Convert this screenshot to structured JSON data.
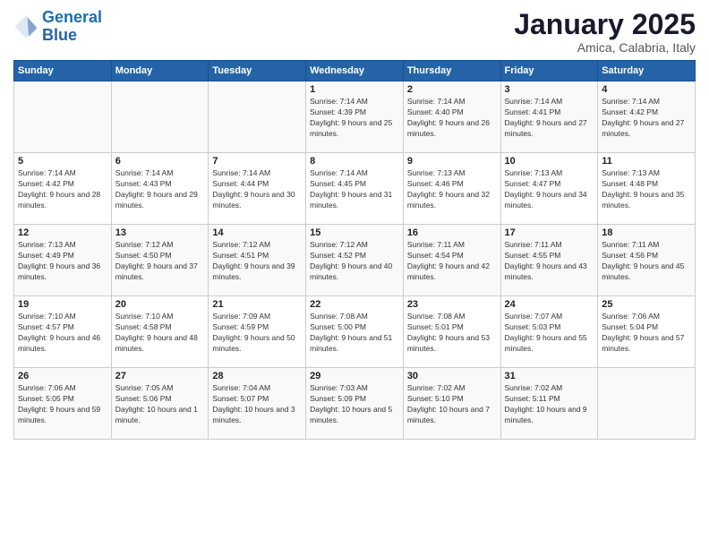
{
  "header": {
    "logo_line1": "General",
    "logo_line2": "Blue",
    "month": "January 2025",
    "location": "Amica, Calabria, Italy"
  },
  "weekdays": [
    "Sunday",
    "Monday",
    "Tuesday",
    "Wednesday",
    "Thursday",
    "Friday",
    "Saturday"
  ],
  "weeks": [
    [
      {
        "day": "",
        "info": ""
      },
      {
        "day": "",
        "info": ""
      },
      {
        "day": "",
        "info": ""
      },
      {
        "day": "1",
        "info": "Sunrise: 7:14 AM\nSunset: 4:39 PM\nDaylight: 9 hours and 25 minutes."
      },
      {
        "day": "2",
        "info": "Sunrise: 7:14 AM\nSunset: 4:40 PM\nDaylight: 9 hours and 26 minutes."
      },
      {
        "day": "3",
        "info": "Sunrise: 7:14 AM\nSunset: 4:41 PM\nDaylight: 9 hours and 27 minutes."
      },
      {
        "day": "4",
        "info": "Sunrise: 7:14 AM\nSunset: 4:42 PM\nDaylight: 9 hours and 27 minutes."
      }
    ],
    [
      {
        "day": "5",
        "info": "Sunrise: 7:14 AM\nSunset: 4:42 PM\nDaylight: 9 hours and 28 minutes."
      },
      {
        "day": "6",
        "info": "Sunrise: 7:14 AM\nSunset: 4:43 PM\nDaylight: 9 hours and 29 minutes."
      },
      {
        "day": "7",
        "info": "Sunrise: 7:14 AM\nSunset: 4:44 PM\nDaylight: 9 hours and 30 minutes."
      },
      {
        "day": "8",
        "info": "Sunrise: 7:14 AM\nSunset: 4:45 PM\nDaylight: 9 hours and 31 minutes."
      },
      {
        "day": "9",
        "info": "Sunrise: 7:13 AM\nSunset: 4:46 PM\nDaylight: 9 hours and 32 minutes."
      },
      {
        "day": "10",
        "info": "Sunrise: 7:13 AM\nSunset: 4:47 PM\nDaylight: 9 hours and 34 minutes."
      },
      {
        "day": "11",
        "info": "Sunrise: 7:13 AM\nSunset: 4:48 PM\nDaylight: 9 hours and 35 minutes."
      }
    ],
    [
      {
        "day": "12",
        "info": "Sunrise: 7:13 AM\nSunset: 4:49 PM\nDaylight: 9 hours and 36 minutes."
      },
      {
        "day": "13",
        "info": "Sunrise: 7:12 AM\nSunset: 4:50 PM\nDaylight: 9 hours and 37 minutes."
      },
      {
        "day": "14",
        "info": "Sunrise: 7:12 AM\nSunset: 4:51 PM\nDaylight: 9 hours and 39 minutes."
      },
      {
        "day": "15",
        "info": "Sunrise: 7:12 AM\nSunset: 4:52 PM\nDaylight: 9 hours and 40 minutes."
      },
      {
        "day": "16",
        "info": "Sunrise: 7:11 AM\nSunset: 4:54 PM\nDaylight: 9 hours and 42 minutes."
      },
      {
        "day": "17",
        "info": "Sunrise: 7:11 AM\nSunset: 4:55 PM\nDaylight: 9 hours and 43 minutes."
      },
      {
        "day": "18",
        "info": "Sunrise: 7:11 AM\nSunset: 4:56 PM\nDaylight: 9 hours and 45 minutes."
      }
    ],
    [
      {
        "day": "19",
        "info": "Sunrise: 7:10 AM\nSunset: 4:57 PM\nDaylight: 9 hours and 46 minutes."
      },
      {
        "day": "20",
        "info": "Sunrise: 7:10 AM\nSunset: 4:58 PM\nDaylight: 9 hours and 48 minutes."
      },
      {
        "day": "21",
        "info": "Sunrise: 7:09 AM\nSunset: 4:59 PM\nDaylight: 9 hours and 50 minutes."
      },
      {
        "day": "22",
        "info": "Sunrise: 7:08 AM\nSunset: 5:00 PM\nDaylight: 9 hours and 51 minutes."
      },
      {
        "day": "23",
        "info": "Sunrise: 7:08 AM\nSunset: 5:01 PM\nDaylight: 9 hours and 53 minutes."
      },
      {
        "day": "24",
        "info": "Sunrise: 7:07 AM\nSunset: 5:03 PM\nDaylight: 9 hours and 55 minutes."
      },
      {
        "day": "25",
        "info": "Sunrise: 7:06 AM\nSunset: 5:04 PM\nDaylight: 9 hours and 57 minutes."
      }
    ],
    [
      {
        "day": "26",
        "info": "Sunrise: 7:06 AM\nSunset: 5:05 PM\nDaylight: 9 hours and 59 minutes."
      },
      {
        "day": "27",
        "info": "Sunrise: 7:05 AM\nSunset: 5:06 PM\nDaylight: 10 hours and 1 minute."
      },
      {
        "day": "28",
        "info": "Sunrise: 7:04 AM\nSunset: 5:07 PM\nDaylight: 10 hours and 3 minutes."
      },
      {
        "day": "29",
        "info": "Sunrise: 7:03 AM\nSunset: 5:09 PM\nDaylight: 10 hours and 5 minutes."
      },
      {
        "day": "30",
        "info": "Sunrise: 7:02 AM\nSunset: 5:10 PM\nDaylight: 10 hours and 7 minutes."
      },
      {
        "day": "31",
        "info": "Sunrise: 7:02 AM\nSunset: 5:11 PM\nDaylight: 10 hours and 9 minutes."
      },
      {
        "day": "",
        "info": ""
      }
    ]
  ]
}
